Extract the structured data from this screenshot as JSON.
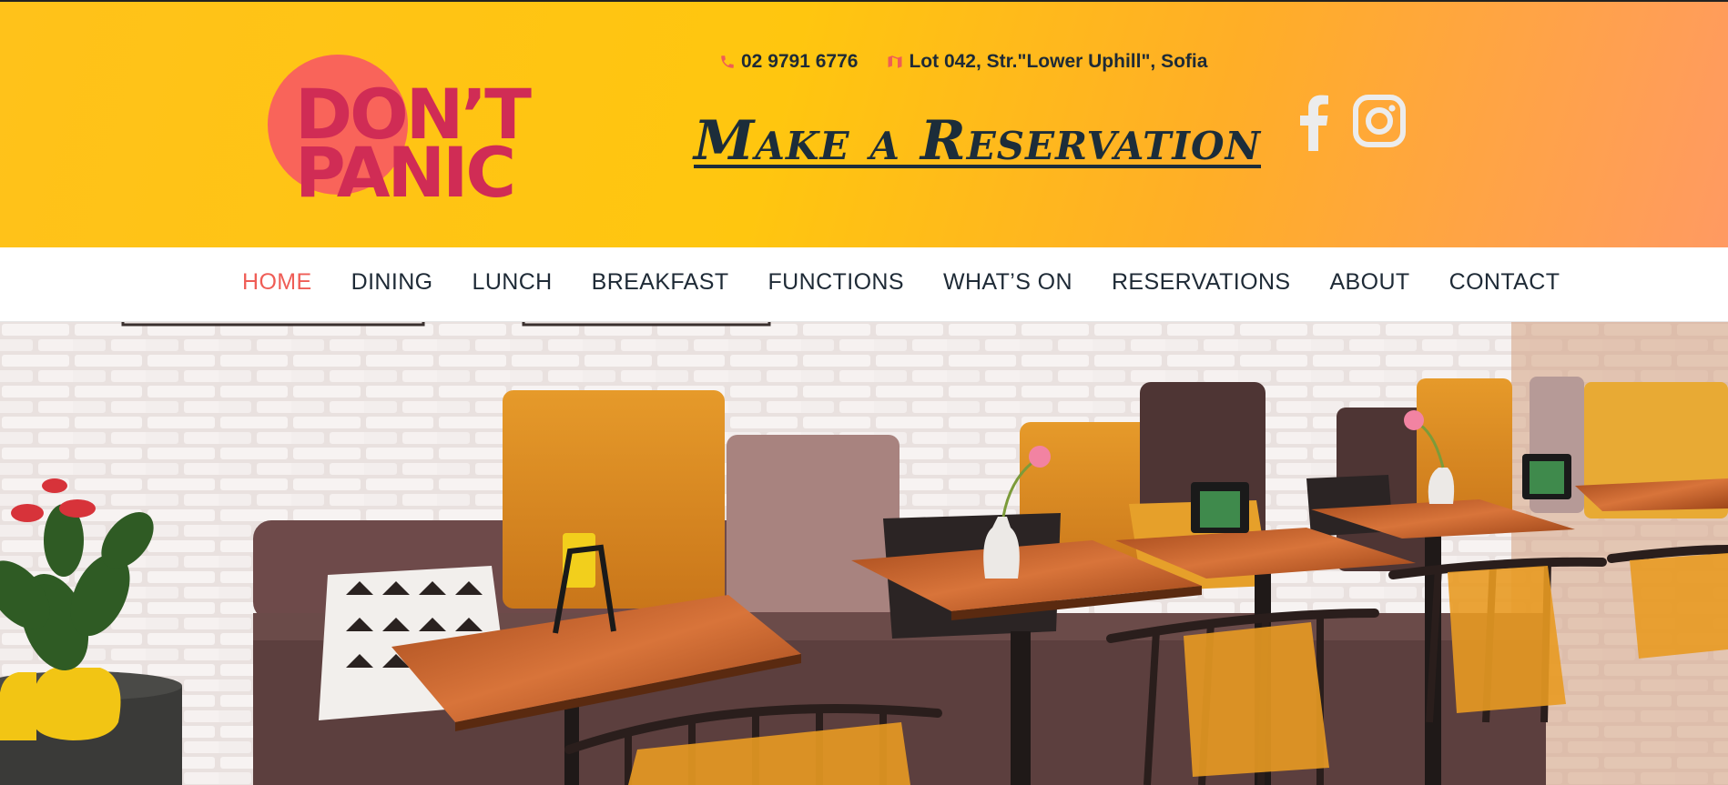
{
  "brand": {
    "logo_line1": "DON’T",
    "logo_line2": "PANIC",
    "accent_color": "#d02c55",
    "circle_color": "#f9645a"
  },
  "contact": {
    "phone_icon": "phone-icon",
    "phone": "02 9791 6776",
    "map_icon": "map-icon",
    "address": "Lot 042, Str.\"Lower Uphill\", Sofia"
  },
  "cta": {
    "label": "Make a Reservation"
  },
  "social": {
    "items": [
      {
        "icon": "facebook-icon"
      },
      {
        "icon": "instagram-icon"
      }
    ]
  },
  "nav": {
    "items": [
      {
        "label": "HOME",
        "active": true
      },
      {
        "label": "DINING"
      },
      {
        "label": "LUNCH"
      },
      {
        "label": "BREAKFAST"
      },
      {
        "label": "FUNCTIONS"
      },
      {
        "label": "WHAT’S ON"
      },
      {
        "label": "RESERVATIONS"
      },
      {
        "label": "ABOUT"
      },
      {
        "label": "CONTACT"
      }
    ],
    "active_color": "#ef5d56",
    "text_color": "#1e2a36"
  },
  "hero": {
    "image": "cafe-interior-photo"
  }
}
